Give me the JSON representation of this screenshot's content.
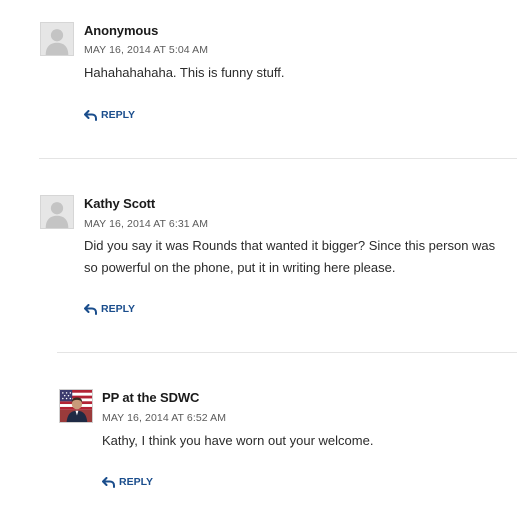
{
  "comments": [
    {
      "author": "Anonymous",
      "date": "MAY 16, 2014 AT 5:04 AM",
      "text": "Hahahahahaha. This is funny stuff.",
      "reply_label": "REPLY",
      "avatar": "default-avatar"
    },
    {
      "author": "Kathy Scott",
      "date": "MAY 16, 2014 AT 6:31 AM",
      "text": "Did you say it was Rounds that wanted it bigger? Since this person was so powerful on the phone, put it in writing here please.",
      "reply_label": "REPLY",
      "avatar": "default-avatar"
    },
    {
      "author": "PP at the SDWC",
      "date": "MAY 16, 2014 AT 6:52 AM",
      "text": "Kathy, I think you have worn out your welcome.",
      "reply_label": "REPLY",
      "avatar": "flag-photo-avatar"
    }
  ],
  "colors": {
    "link": "#1a4d8c",
    "text": "#2b2b2b",
    "meta": "#5a5a5a",
    "divider": "#e4e4e4"
  }
}
